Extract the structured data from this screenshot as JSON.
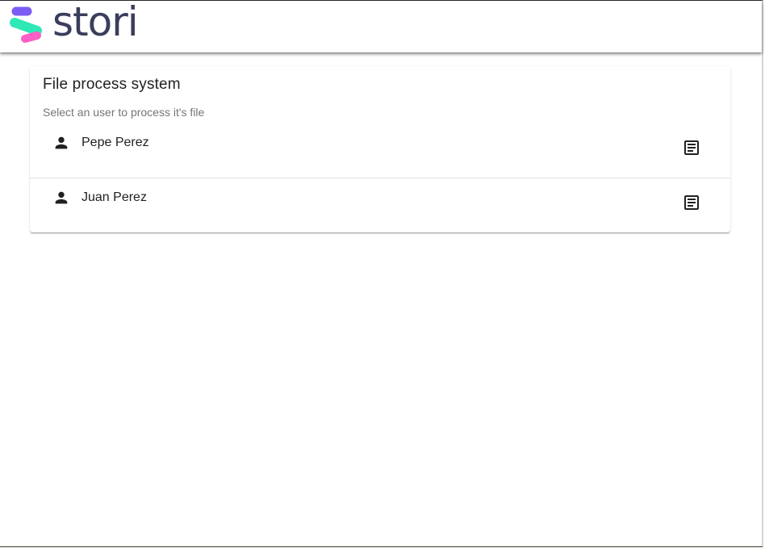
{
  "header": {
    "brand_name": "stori",
    "brand_colors": {
      "text": "#3a3d5c",
      "mark_top": "#7b5cf5",
      "mark_middle": "#2ee8b6",
      "mark_bottom": "#ff5ec4"
    }
  },
  "card": {
    "title": "File process system",
    "subtitle": "Select an user to process it's file"
  },
  "users": [
    {
      "name": "Pepe Perez",
      "icon": "person-icon",
      "action_icon": "file-document-icon"
    },
    {
      "name": "Juan Perez",
      "icon": "person-icon",
      "action_icon": "file-document-icon"
    }
  ]
}
